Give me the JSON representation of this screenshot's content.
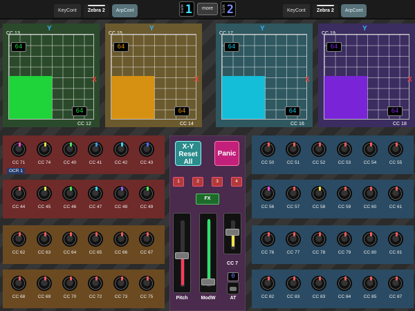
{
  "top": {
    "left_tabs": [
      "KeyCont",
      "Zebra 2",
      "ArpCont"
    ],
    "right_tabs": [
      "KeyCont",
      "Zebra 2",
      "ArpCont"
    ],
    "bank1": {
      "label": "bank",
      "number": "1"
    },
    "bank2": {
      "label": "bank",
      "number": "2"
    },
    "more": "more"
  },
  "pads": [
    {
      "cc_y": "CC 13",
      "cc_x": "CC 12",
      "y_axis": "Y",
      "x_axis": "X",
      "val_y": "64",
      "val_x": "64"
    },
    {
      "cc_y": "CC 15",
      "cc_x": "CC 14",
      "y_axis": "Y",
      "x_axis": "X",
      "val_y": "64",
      "val_x": "64"
    },
    {
      "cc_y": "CC 17",
      "cc_x": "CC 16",
      "y_axis": "Y",
      "x_axis": "X",
      "val_y": "64",
      "val_x": "64"
    },
    {
      "cc_y": "CC 19",
      "cc_x": "CC 18",
      "y_axis": "Y",
      "x_axis": "X",
      "val_y": "64",
      "val_x": "64"
    }
  ],
  "colors": {
    "pad1": "#1fd33a",
    "pad2": "#d69112",
    "pad3": "#15bed8",
    "pad4": "#7a24d8",
    "panel_red": "#6f2a2a",
    "panel_orange": "#6b4a22",
    "panel_blue": "#2a4b63",
    "panel_green_bg": "#2f4a2f",
    "panel_purple": "#4a2a4d"
  },
  "left_rows": [
    [
      "CC 71",
      "CC 74",
      "CC 40",
      "CC 41",
      "CC 42",
      "CC 43"
    ],
    [
      "CC 44",
      "CC 45",
      "CC 46",
      "CC 47",
      "CC 48",
      "CC 49"
    ],
    [
      "CC 62",
      "CC 63",
      "CC 64",
      "CC 65",
      "CC 66",
      "CC 67"
    ],
    [
      "CC 68",
      "CC 69",
      "CC 70",
      "CC 72",
      "CC 73",
      "CC 75"
    ]
  ],
  "right_rows": [
    [
      "CC 50",
      "CC 51",
      "CC 52",
      "CC 53",
      "CC 54",
      "CC 55"
    ],
    [
      "CC 56",
      "CC 57",
      "CC 58",
      "CC 59",
      "CC 60",
      "CC 61"
    ],
    [
      "CC 76",
      "CC 77",
      "CC 78",
      "CC 79",
      "CC 80",
      "CC 81"
    ],
    [
      "CC 82",
      "CC 83",
      "CC 83",
      "CC 84",
      "CC 85",
      "CC 87"
    ]
  ],
  "ocr_label": "OCR 1",
  "center": {
    "xy_reset": "X-Y Reset All",
    "panic": "Panic",
    "num_buttons": [
      "1",
      "2",
      "3",
      "4"
    ],
    "fx": "FX",
    "sliders": [
      {
        "label": "Pitch",
        "value": "0"
      },
      {
        "label": "ModW",
        "value": "0"
      },
      {
        "label": "CC 7",
        "value": "64"
      }
    ],
    "at_label": "AT",
    "at_value": "0"
  }
}
